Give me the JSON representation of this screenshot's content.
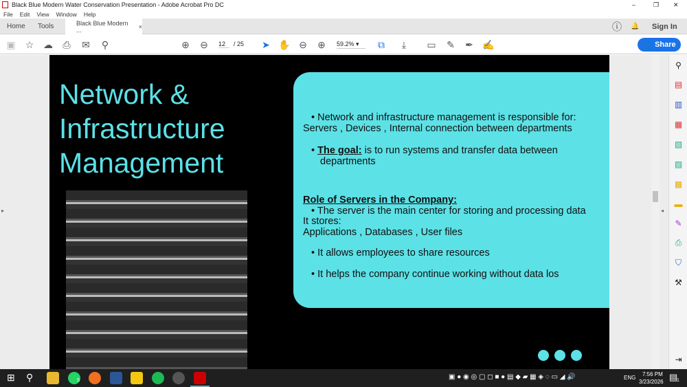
{
  "window": {
    "title": "Black Blue Modern Water Conservation Presentation - Adobe Acrobat Pro DC",
    "minimize": "–",
    "restore": "❐",
    "close": "✕"
  },
  "menu": [
    "File",
    "Edit",
    "View",
    "Window",
    "Help"
  ],
  "tabs": {
    "home": "Home",
    "tools": "Tools",
    "doc": "Black Blue Modern ...",
    "close": "×",
    "sign_in": "Sign In"
  },
  "toolbar": {
    "page_current": "12",
    "page_sep": "/",
    "page_total": "25",
    "zoom": "59.2%",
    "share": "Share"
  },
  "slide": {
    "title_lines": [
      "Network &",
      "Infrastructure",
      "Management"
    ],
    "bullet1": "Network and infrastructure management is responsible for:",
    "line1b": "Servers , Devices , Internal connection between departments",
    "goal_label": "The goal:",
    "goal_text": " is to run systems and transfer data between",
    "goal_text2": "departments",
    "role_heading": "Role of Servers in the Company:",
    "bullet_server": "The server is the main center for storing and processing data",
    "it_stores": "It stores:",
    "stores_list": "Applications , Databases , User files",
    "bullet_share": "It allows employees to share resources",
    "bullet_continue": "It helps the company continue working without data los"
  },
  "taskbar": {
    "lang": "ENG",
    "time": "7:56 PM",
    "date": "3/23/2026",
    "whatsapp_badge": "5",
    "notif_badge": "1"
  }
}
